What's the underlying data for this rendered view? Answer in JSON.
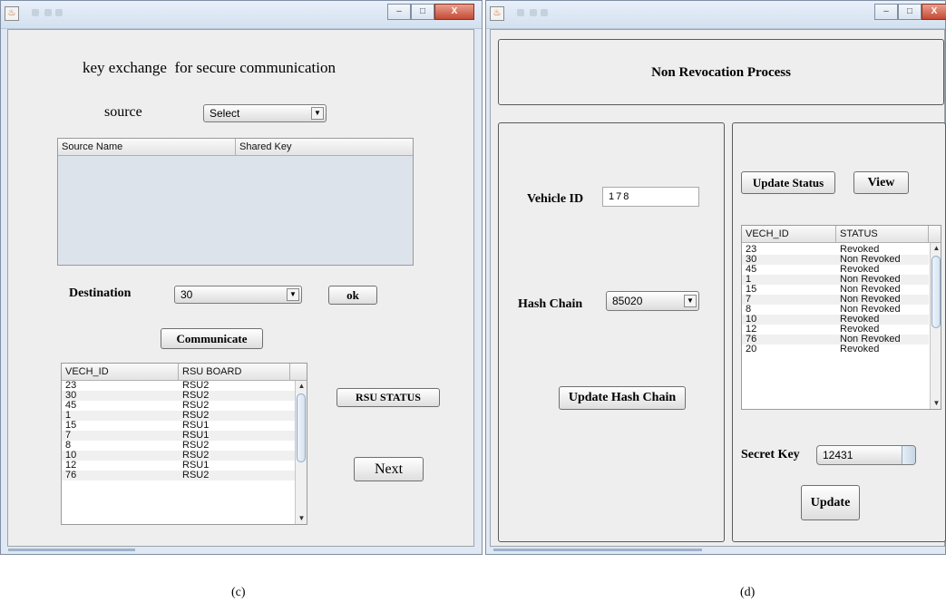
{
  "left_window": {
    "header": "key exchange  for secure communication",
    "source_label": "source",
    "source_select": "Select",
    "source_table": {
      "columns": [
        "Source Name",
        "Shared Key"
      ]
    },
    "destination_label": "Destination",
    "destination_select": "30",
    "ok_button": "ok",
    "communicate_button": "Communicate",
    "rsu_status_button": "RSU STATUS",
    "next_button": "Next",
    "vech_table": {
      "columns": [
        "VECH_ID",
        "RSU BOARD"
      ],
      "rows": [
        [
          "23",
          "RSU2"
        ],
        [
          "30",
          "RSU2"
        ],
        [
          "45",
          "RSU2"
        ],
        [
          "1",
          "RSU2"
        ],
        [
          "15",
          "RSU1"
        ],
        [
          "7",
          "RSU1"
        ],
        [
          "8",
          "RSU2"
        ],
        [
          "10",
          "RSU2"
        ],
        [
          "12",
          "RSU1"
        ],
        [
          "76",
          "RSU2"
        ]
      ]
    }
  },
  "right_window": {
    "header": "Non Revocation Process",
    "vehicle_id_label": "Vehicle ID",
    "vehicle_id_value": "178",
    "hash_chain_label": "Hash Chain",
    "hash_chain_select": "85020",
    "update_hash_chain_button": "Update Hash Chain",
    "update_status_button": "Update Status",
    "view_button": "View",
    "status_table": {
      "columns": [
        "VECH_ID",
        "STATUS"
      ],
      "rows": [
        [
          "23",
          "Revoked"
        ],
        [
          "30",
          "Non Revoked"
        ],
        [
          "45",
          "Revoked"
        ],
        [
          "1",
          "Non Revoked"
        ],
        [
          "15",
          "Non Revoked"
        ],
        [
          "7",
          "Non Revoked"
        ],
        [
          "8",
          "Non Revoked"
        ],
        [
          "10",
          "Revoked"
        ],
        [
          "12",
          "Revoked"
        ],
        [
          "76",
          "Non Revoked"
        ],
        [
          "20",
          "Revoked"
        ]
      ]
    },
    "secret_key_label": "Secret Key",
    "secret_key_value": "12431",
    "update_button": "Update"
  },
  "captions": {
    "left": "(c)",
    "right": "(d)"
  },
  "window_controls": {
    "minimize": "–",
    "maximize": "□",
    "close": "X"
  }
}
